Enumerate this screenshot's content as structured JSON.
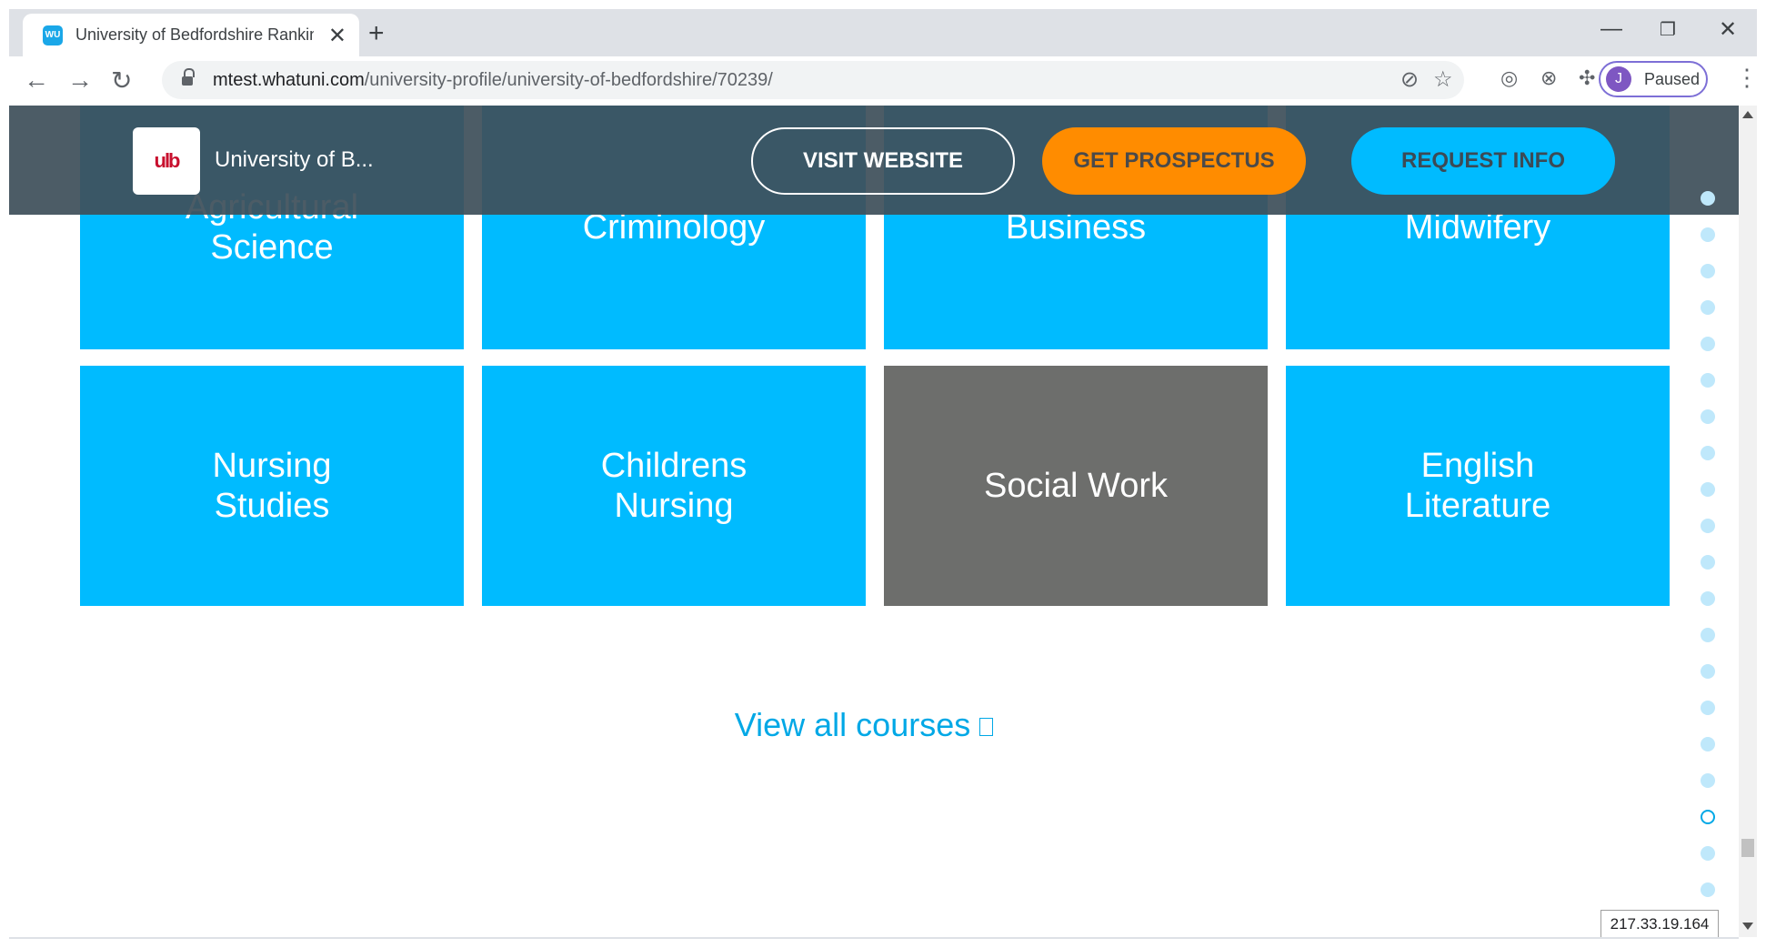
{
  "browser": {
    "tab_title": "University of Bedfordshire Rankin",
    "tab_favicon_text": "WU",
    "url_host": "mtest.whatuni.com",
    "url_path": "/university-profile/university-of-bedfordshire/70239/",
    "profile_initial": "J",
    "profile_status": "Paused",
    "icons": [
      "back-arrow-icon",
      "forward-arrow-icon",
      "reload-icon",
      "lock-icon",
      "blocked-tracker-icon",
      "star-icon",
      "extension-icon",
      "puzzle-icon",
      "menu-icon"
    ]
  },
  "header": {
    "university_name": "University of B...",
    "logo_mark": "ulb",
    "visit_label": "VISIT WEBSITE",
    "prospectus_label": "GET PROSPECTUS",
    "request_label": "REQUEST INFO"
  },
  "courses": {
    "row1": [
      "Agricultural Science",
      "Criminology",
      "Business",
      "Midwifery"
    ],
    "row2": [
      "Nursing Studies",
      "Childrens Nursing",
      "Social Work",
      "English Literature"
    ],
    "view_all_label": "View all courses"
  },
  "colors": {
    "tile": "#00bbff",
    "tile_hover": "#6d6e6c",
    "prospectus": "#ff8c00",
    "link": "#00a8e6"
  },
  "status": {
    "ip_address": "217.33.19.164"
  }
}
